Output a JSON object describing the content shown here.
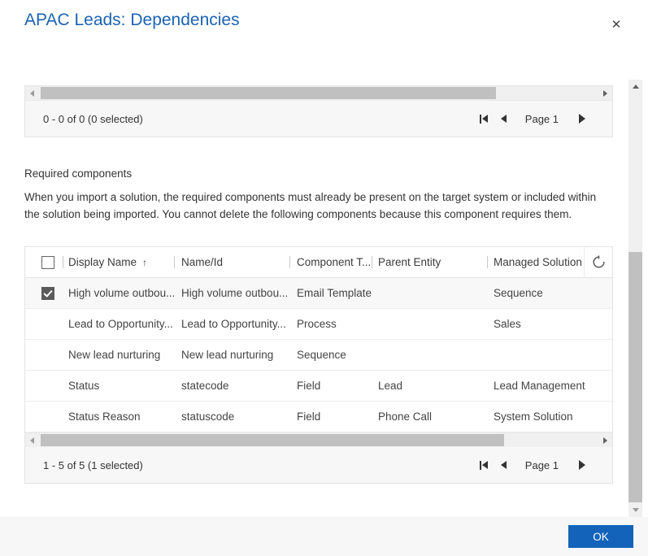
{
  "dialog": {
    "title": "APAC Leads: Dependencies",
    "close_icon": "close-icon",
    "ok_label": "OK"
  },
  "top_grid": {
    "pager": {
      "count_text": "0 - 0 of 0 (0 selected)",
      "page_label": "Page 1",
      "first_icon": "first-page-icon",
      "prev_icon": "previous-page-icon",
      "next_icon": "next-page-icon"
    },
    "scrollbar": {
      "left_arrow_icon": "scroll-left-icon",
      "right_arrow_icon": "scroll-right-icon"
    }
  },
  "required_components": {
    "heading": "Required components",
    "description": "When you import a solution, the required components must already be present on the target system or included within the solution being imported. You cannot delete the following components because this component requires them."
  },
  "grid": {
    "select_all_checkbox": false,
    "refresh_icon": "refresh-spinner-icon",
    "columns": [
      {
        "label": "Display Name",
        "sort": "↑"
      },
      {
        "label": "Name/Id",
        "sort": ""
      },
      {
        "label": "Component T...",
        "sort": ""
      },
      {
        "label": "Parent Entity",
        "sort": ""
      },
      {
        "label": "Managed Solution",
        "sort": ""
      }
    ],
    "rows": [
      {
        "selected": true,
        "display_name": "High volume outbou...",
        "name_id": "High volume outbou...",
        "component_type": "Email Template",
        "parent_entity": "",
        "managed_solution": "Sequence"
      },
      {
        "selected": false,
        "display_name": "Lead to Opportunity...",
        "name_id": "Lead to Opportunity...",
        "component_type": "Process",
        "parent_entity": "",
        "managed_solution": "Sales"
      },
      {
        "selected": false,
        "display_name": "New lead nurturing",
        "name_id": "New lead nurturing",
        "component_type": "Sequence",
        "parent_entity": "",
        "managed_solution": ""
      },
      {
        "selected": false,
        "display_name": "Status",
        "name_id": "statecode",
        "component_type": "Field",
        "parent_entity": "Lead",
        "managed_solution": "Lead Management"
      },
      {
        "selected": false,
        "display_name": "Status Reason",
        "name_id": "statuscode",
        "component_type": "Field",
        "parent_entity": "Phone Call",
        "managed_solution": "System Solution"
      }
    ],
    "pager": {
      "count_text": "1 - 5 of 5 (1 selected)",
      "page_label": "Page 1",
      "first_icon": "first-page-icon",
      "prev_icon": "previous-page-icon",
      "next_icon": "next-page-icon"
    },
    "scrollbar": {
      "left_arrow_icon": "scroll-left-icon",
      "right_arrow_icon": "scroll-right-icon"
    }
  },
  "window_scrollbar": {
    "up_arrow_icon": "scroll-up-icon",
    "down_arrow_icon": "scroll-down-icon"
  },
  "colors": {
    "title": "#1b63b3",
    "accent": "#1363ba",
    "panel_border": "#e4e4e4",
    "pager_bg": "#f7f7f7",
    "scroll_thumb": "#c0c0c0"
  }
}
